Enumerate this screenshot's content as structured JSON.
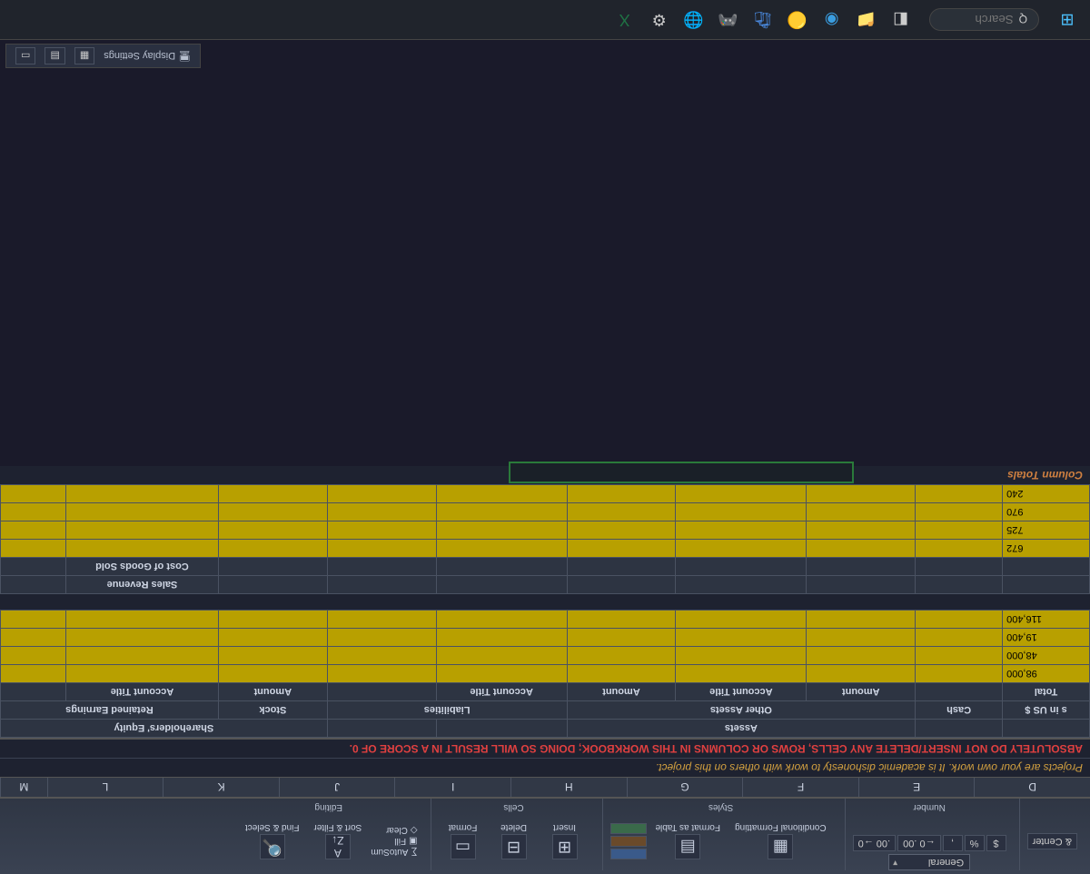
{
  "ribbon": {
    "number_group": "Number",
    "format_dropdown": "General",
    "currency": "$",
    "percent": "%",
    "comma": ",",
    "inc_dec": "←0 .00",
    "dec_dec": ".00 →0",
    "styles_group": "Styles",
    "cond_fmt": "Conditional Formatting",
    "fmt_table": "Format as Table",
    "cells_group": "Cells",
    "insert": "Insert",
    "delete": "Delete",
    "format": "Format",
    "editing_group": "Editing",
    "autosum": "AutoSum",
    "fill": "Fill",
    "clear": "Clear",
    "sort": "Sort & Filter",
    "find": "Find & Select",
    "center": "& Center"
  },
  "cols": [
    "D",
    "E",
    "F",
    "G",
    "H",
    "I",
    "J",
    "K",
    "L",
    "M"
  ],
  "notes": {
    "own_work": "Projects are your own work. It is academic dishonesty to work with others on this project.",
    "warning": "ABSOLUTELY DO NOT INSERT/DELETE ANY CELLS, ROWS OR COLUMNS IN THIS WORKBOOK; DOING SO WILL RESULT IN A SCORE OF 0."
  },
  "headers": {
    "in_us": "s in US $",
    "assets": "Assets",
    "shareholders_equity": "Shareholders' Equity",
    "total": "Total",
    "cash": "Cash",
    "other_assets": "Other Assets",
    "liabilities": "Liabilities",
    "stock": "Stock",
    "retained_earnings": "Retained Earnings",
    "amount": "Amount",
    "account_title": "Account Title",
    "sales_revenue": "Sales Revenue",
    "cogs": "Cost of Goods Sold"
  },
  "section1_vals": [
    "98,000",
    "48,000",
    "19,400",
    "116,400"
  ],
  "section2a_vals": [
    "672",
    "725",
    "970",
    "240"
  ],
  "column_totals": "Column Totals",
  "statusbar": {
    "display_settings": "Display Settings"
  },
  "taskbar": {
    "search_placeholder": "Search",
    "search_icon_label": "Q"
  }
}
